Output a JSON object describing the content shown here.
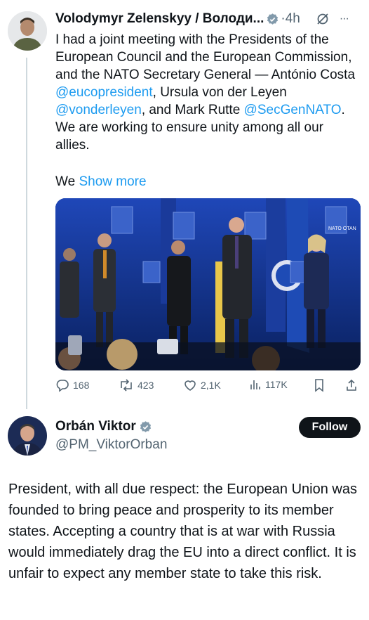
{
  "tweet": {
    "author": "Volodymyr Zelenskyy / Володи...",
    "time": "·4h",
    "more": "···",
    "text_before": "I had a joint meeting with the Presidents of the European Council and the European Commission, and the NATO Secretary General — António Costa ",
    "mention1": "@eucopresident",
    "text_mid1": ", Ursula von der Leyen ",
    "mention2": "@vonderleyen",
    "text_mid2": ", and Mark Rutte ",
    "mention3": "@SecGenNATO",
    "text_after": ". We are working to ensure unity among all our allies.",
    "truncated_prefix": "We",
    "show_more": "Show more",
    "photo_banner": "NATO OTAN",
    "stats": {
      "replies": "168",
      "reposts": "423",
      "likes": "2,1K",
      "views": "117K"
    }
  },
  "reply": {
    "author": "Orbán Viktor",
    "handle": "@PM_ViktorOrban",
    "follow_label": "Follow",
    "text": "President, with all due respect: the European Union was founded to bring peace and prosperity to its member states. Accepting a country that is at war with Russia would immediately drag the EU into a direct conflict. It is unfair to expect any member state to take this risk."
  },
  "colors": {
    "accent": "#1d9bf0",
    "verified": "#829aab",
    "text": "#0f1419",
    "muted": "#536471"
  }
}
